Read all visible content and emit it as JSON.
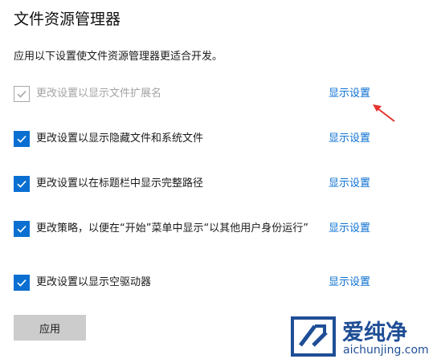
{
  "window": {
    "title": "文件资源管理器",
    "description": "应用以下设置使文件资源管理器更适合开发。"
  },
  "settings": [
    {
      "label": "更改设置以显示文件扩展名",
      "link": "显示设置",
      "checked": true,
      "disabled": true
    },
    {
      "label": "更改设置以显示隐藏文件和系统文件",
      "link": "显示设置",
      "checked": true,
      "disabled": false
    },
    {
      "label": "更改设置以在标题栏中显示完整路径",
      "link": "显示设置",
      "checked": true,
      "disabled": false
    },
    {
      "label": "更改策略，以便在“开始”菜单中显示“以其他用户身份运行”",
      "link": "显示设置",
      "checked": true,
      "disabled": false
    },
    {
      "label": "更改设置以显示空驱动器",
      "link": "显示设置",
      "checked": true,
      "disabled": false
    }
  ],
  "apply_button": {
    "label": "应用"
  },
  "watermark": {
    "brand": "爱纯净",
    "url": "aichunjing.com"
  },
  "colors": {
    "accent": "#0a6fd1",
    "checkbox_disabled": "#a8a8a8",
    "text_disabled": "#a3a3a3",
    "button_bg": "#cccccc",
    "annotation_arrow": "#e5322d",
    "watermark": "#1f4e96"
  },
  "icons": {
    "checkbox": "checkmark-icon",
    "annotation": "red-arrow-icon",
    "watermark_logo": "aichunjing-logo-icon"
  }
}
